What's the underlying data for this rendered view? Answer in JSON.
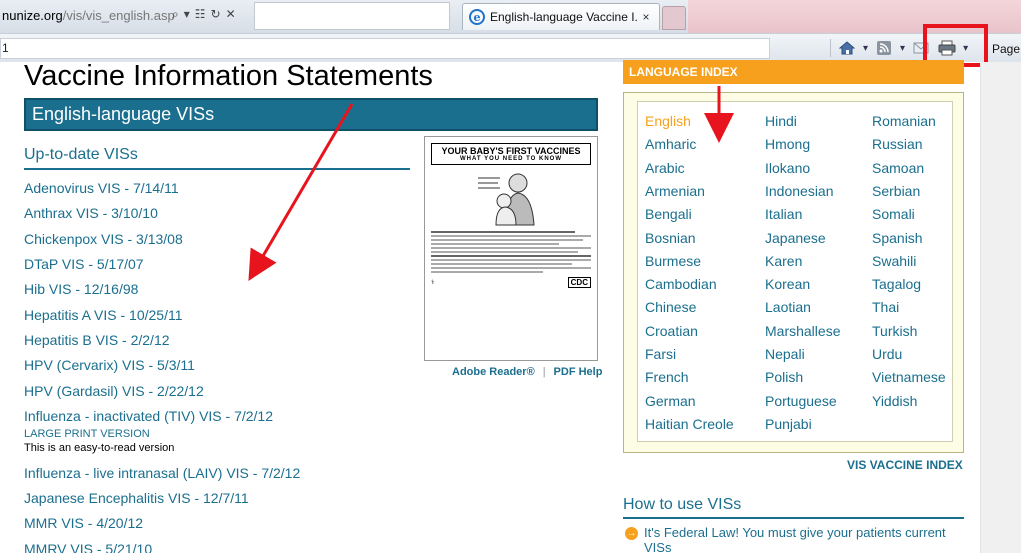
{
  "browser": {
    "address_host": "nunize.org",
    "address_path": "/vis/vis_english.asp",
    "tab_title": "English-language Vaccine I...",
    "tab_close": "×",
    "favorites_field": "1",
    "page_menu": "Page"
  },
  "page": {
    "title": "Vaccine Information Statements",
    "section_title": "English-language VISs",
    "uptodate_heading": "Up-to-date VISs",
    "vis_links": [
      "Adenovirus VIS - 7/14/11",
      "Anthrax VIS - 3/10/10",
      "Chickenpox VIS - 3/13/08",
      "DTaP VIS - 5/17/07",
      "Hib VIS - 12/16/98",
      "Hepatitis A VIS - 10/25/11",
      "Hepatitis B VIS - 2/2/12",
      "HPV (Cervarix) VIS - 5/3/11",
      "HPV (Gardasil) VIS - 2/22/12",
      "Influenza - inactivated (TIV) VIS - 7/2/12",
      "Influenza - live intranasal (LAIV) VIS - 7/2/12",
      "Japanese Encephalitis VIS - 12/7/11",
      "MMR VIS - 4/20/12",
      "MMRV VIS - 5/21/10"
    ],
    "large_print": "LARGE PRINT VERSION",
    "easy_read_note": "This is an easy-to-read version",
    "thumbnail": {
      "title_line1": "YOUR BABY'S FIRST VACCINES",
      "title_line2": "WHAT YOU NEED TO KNOW",
      "agency": "CDC"
    },
    "adobe_reader": "Adobe Reader®",
    "separator": "|",
    "pdf_help": "PDF Help"
  },
  "language_index": {
    "header": "LANGUAGE INDEX",
    "columns": [
      [
        "English",
        "Amharic",
        "Arabic",
        "Armenian",
        "Bengali",
        "Bosnian",
        "Burmese",
        "Cambodian",
        "Chinese",
        "Croatian",
        "Farsi",
        "French",
        "German",
        "Haitian Creole"
      ],
      [
        "Hindi",
        "Hmong",
        "Ilokano",
        "Indonesian",
        "Italian",
        "Japanese",
        "Karen",
        "Korean",
        "Laotian",
        "Marshallese",
        "Nepali",
        "Polish",
        "Portuguese",
        "Punjabi"
      ],
      [
        "Romanian",
        "Russian",
        "Samoan",
        "Serbian",
        "Somali",
        "Spanish",
        "Swahili",
        "Tagalog",
        "Thai",
        "Turkish",
        "Urdu",
        "Vietnamese",
        "Yiddish"
      ]
    ],
    "selected": "English",
    "vis_vaccine_index": "VIS VACCINE INDEX"
  },
  "howto": {
    "heading": "How to use VISs",
    "item1": "It's Federal Law! You must give your patients current VISs"
  },
  "colors": {
    "accent_teal": "#1b6f8e",
    "orange": "#f7a01d",
    "annotation_red": "#e8141d"
  }
}
